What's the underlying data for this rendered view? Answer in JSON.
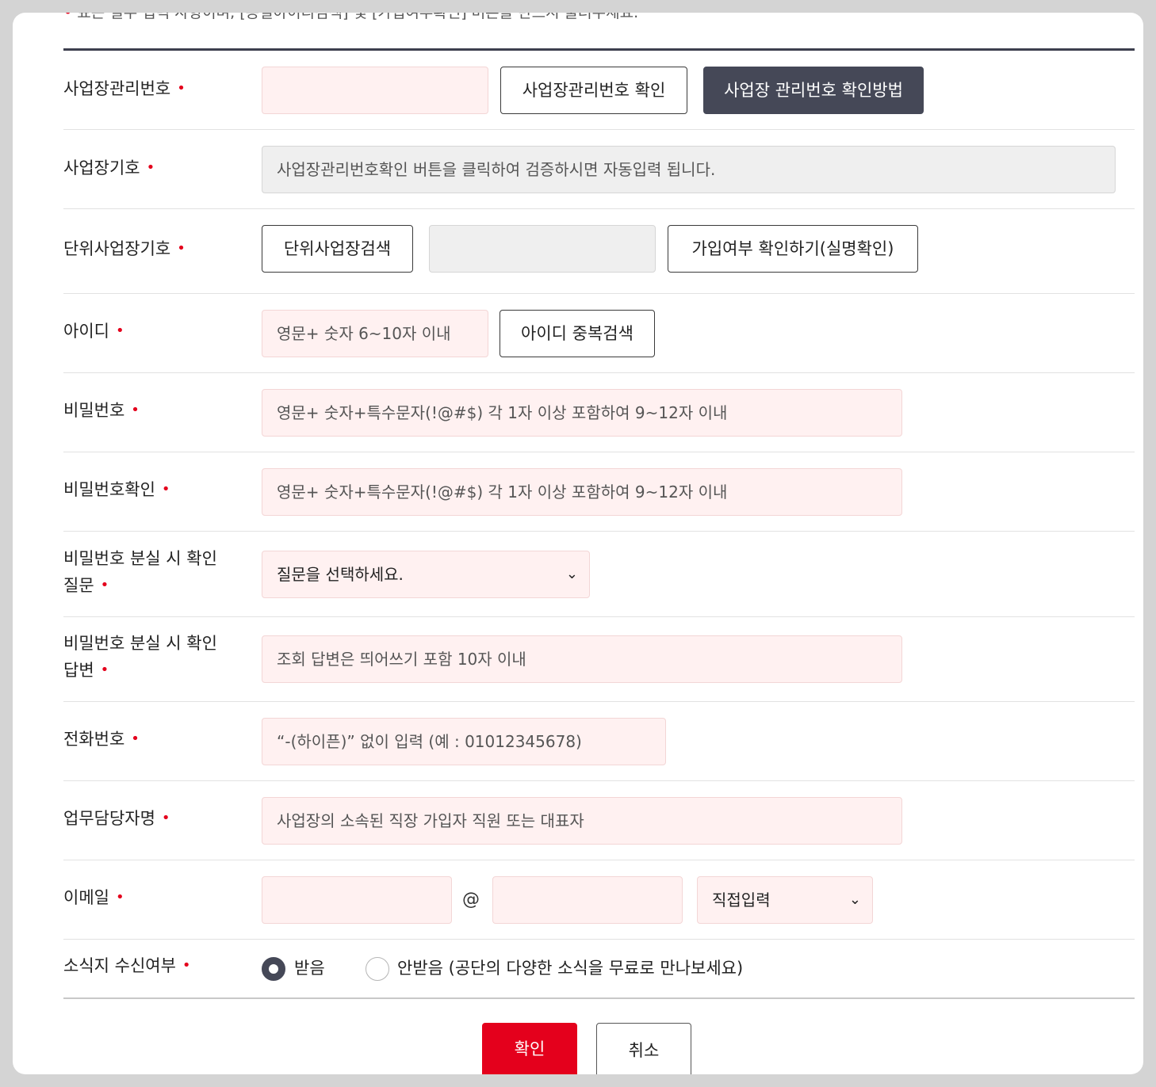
{
  "notice": {
    "text": "표는 필수 입력 사항이며, [동일아이디검색] 및 [가입여부확인] 버튼을 반드시 눌러주세요."
  },
  "required_marker": "•",
  "rows": {
    "biz_mgmt_no": {
      "label": "사업장관리번호",
      "input_value": "",
      "check_button": "사업장관리번호 확인",
      "method_button": "사업장 관리번호 확인방법"
    },
    "biz_symbol": {
      "label": "사업장기호",
      "value": "사업장관리번호확인 버튼을 클릭하여 검증하시면 자동입력 됩니다."
    },
    "unit_biz_symbol": {
      "label": "단위사업장기호",
      "search_button": "단위사업장검색",
      "value": "",
      "verify_button": "가입여부 확인하기(실명확인)"
    },
    "user_id": {
      "label": "아이디",
      "placeholder": "영문+ 숫자 6~10자 이내",
      "dup_button": "아이디 중복검색"
    },
    "password": {
      "label": "비밀번호",
      "placeholder": "영문+ 숫자+특수문자(!@#$) 각 1자 이상 포함하여 9~12자 이내"
    },
    "password_confirm": {
      "label": "비밀번호확인",
      "placeholder": "영문+ 숫자+특수문자(!@#$) 각 1자 이상 포함하여 9~12자 이내"
    },
    "lost_question": {
      "label_line1": "비밀번호 분실 시 확인",
      "label_line2": "질문",
      "selected": "질문을 선택하세요."
    },
    "lost_answer": {
      "label_line1": "비밀번호 분실 시 확인",
      "label_line2": "답변",
      "placeholder": "조회 답변은 띄어쓰기 포함 10자 이내"
    },
    "phone": {
      "label": "전화번호",
      "placeholder": "“-(하이픈)” 없이 입력 (예 : 01012345678)"
    },
    "manager": {
      "label": "업무담당자명",
      "placeholder": "사업장의 소속된 직장 가입자 직원 또는 대표자"
    },
    "email": {
      "label": "이메일",
      "local": "",
      "at": "@",
      "domain": "",
      "domain_select": "직접입력"
    },
    "newsletter": {
      "label": "소식지 수신여부",
      "option_yes": "받음",
      "option_no": "안받음 (공단의 다양한 소식을 무료로 만나보세요)",
      "selected": "받음"
    }
  },
  "actions": {
    "confirm": "확인",
    "cancel": "취소"
  },
  "icons": {
    "chevron": "chevron-down-icon"
  },
  "colors": {
    "required": "#e4001c",
    "dark_button": "#454857",
    "input_bg": "#fff1f1",
    "confirm_button": "#e4001c"
  }
}
